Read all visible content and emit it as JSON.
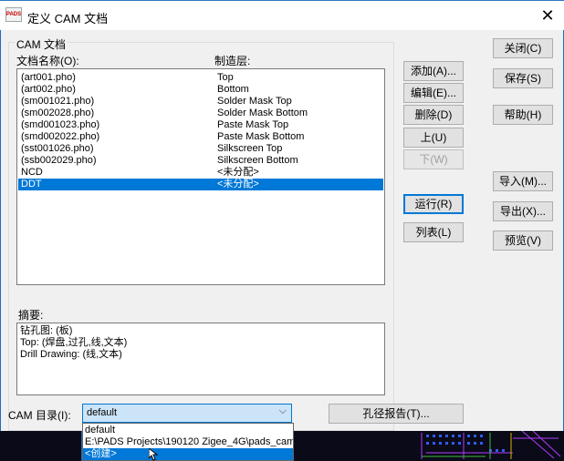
{
  "window": {
    "title": "定义 CAM 文档",
    "app_icon_text": "PADS",
    "close_glyph": "✕"
  },
  "group": {
    "label": "CAM 文档"
  },
  "list": {
    "col1_header": "文档名称(O):",
    "col2_header": "制造层:",
    "rows": [
      {
        "name": "(art001.pho)",
        "layer": "Top"
      },
      {
        "name": "(art002.pho)",
        "layer": "Bottom"
      },
      {
        "name": "(sm001021.pho)",
        "layer": "Solder Mask Top"
      },
      {
        "name": "(sm002028.pho)",
        "layer": "Solder Mask Bottom"
      },
      {
        "name": "(smd001023.pho)",
        "layer": "Paste Mask Top"
      },
      {
        "name": "(smd002022.pho)",
        "layer": "Paste Mask Bottom"
      },
      {
        "name": "(sst001026.pho)",
        "layer": "Silkscreen Top"
      },
      {
        "name": "(ssb002029.pho)",
        "layer": "Silkscreen Bottom"
      },
      {
        "name": "NCD",
        "layer": "<未分配>"
      },
      {
        "name": "DDT",
        "layer": "<未分配>"
      }
    ],
    "selected_index": 9
  },
  "summary": {
    "label": "摘要:",
    "lines": [
      "钻孔图: (板)",
      "Top: (焊盘,过孔,线,文本)",
      "Drill Drawing: (线,文本)"
    ]
  },
  "buttons": {
    "add": "添加(A)...",
    "edit": "编辑(E)...",
    "delete": "删除(D)",
    "up": "上(U)",
    "down": "下(W)",
    "run": "运行(R)",
    "list": "列表(L)",
    "close": "关闭(C)",
    "save": "保存(S)",
    "help": "帮助(H)",
    "import": "导入(M)...",
    "export": "导出(X)...",
    "preview": "预览(V)",
    "drill_report": "孔径报告(T)..."
  },
  "cam_dir": {
    "label": "CAM 目录(I):",
    "value": "default",
    "arrow_glyph": "⌵",
    "options": [
      "default",
      "E:\\PADS Projects\\190120 Zigee_4G\\pads_cam",
      "<创建>"
    ],
    "highlighted_index": 2
  },
  "colors": {
    "titlebar_border": "#2b78c5",
    "selection": "#0078d7",
    "dialog_bg": "#f0f0f0",
    "button_bg": "#e1e1e1"
  }
}
